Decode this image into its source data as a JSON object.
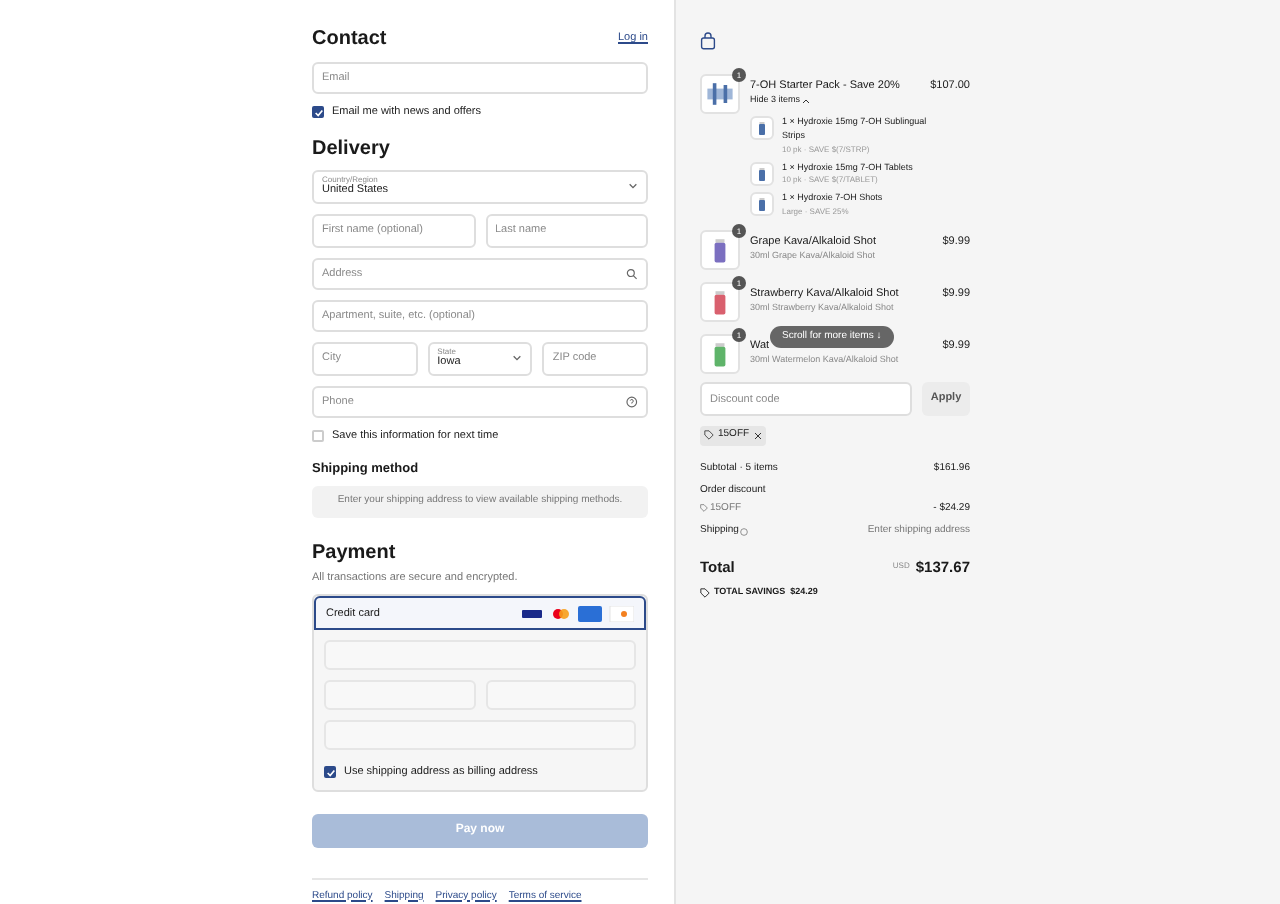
{
  "contact": {
    "title": "Contact",
    "login_link": "Log in",
    "email": {
      "placeholder": "Email"
    },
    "news_checkbox": {
      "label": "Email me with news and offers",
      "checked": true
    }
  },
  "delivery": {
    "title": "Delivery",
    "country": {
      "label": "Country/Region",
      "value": "United States"
    },
    "first_name": {
      "placeholder": "First name (optional)"
    },
    "last_name": {
      "placeholder": "Last name"
    },
    "address": {
      "placeholder": "Address"
    },
    "apartment": {
      "placeholder": "Apartment, suite, etc. (optional)"
    },
    "city": {
      "placeholder": "City"
    },
    "state": {
      "label": "State",
      "value": "Iowa"
    },
    "zip": {
      "placeholder": "ZIP code"
    },
    "phone": {
      "placeholder": "Phone"
    },
    "save_checkbox": {
      "label": "Save this information for next time",
      "checked": false
    }
  },
  "shipping_method": {
    "title": "Shipping method",
    "message": "Enter your shipping address to view available shipping methods."
  },
  "payment": {
    "title": "Payment",
    "subtitle": "All transactions are secure and encrypted.",
    "method": "Credit card",
    "billing_checkbox": {
      "label": "Use shipping address as billing address",
      "checked": true
    }
  },
  "pay_button": {
    "label": "Pay now",
    "disabled": true
  },
  "footer_links": [
    "Refund policy",
    "Shipping",
    "Privacy policy",
    "Terms of service"
  ],
  "order": {
    "items": [
      {
        "name": "7-OH Starter Pack - Save 20%",
        "quantity": "1",
        "price": "$107.00",
        "toggle": "Hide 3 items",
        "expanded": true,
        "children": [
          {
            "name": "1 × Hydroxie 15mg 7-OH Sublingual Strips",
            "detail": "10 pk · SAVE $(7/STRP)"
          },
          {
            "name": "1 × Hydroxie 15mg 7-OH Tablets",
            "detail": "10 pk · SAVE $(7/TABLET)"
          },
          {
            "name": "1 × Hydroxie 7-OH Shots",
            "detail": "Large · SAVE 25%"
          }
        ]
      },
      {
        "name": "Grape Kava/Alkaloid Shot",
        "detail": "30ml Grape Kava/Alkaloid Shot",
        "quantity": "1",
        "price": "$9.99",
        "color": "#7b6fc0"
      },
      {
        "name": "Strawberry Kava/Alkaloid Shot",
        "detail": "30ml Strawberry Kava/Alkaloid Shot",
        "quantity": "1",
        "price": "$9.99",
        "color": "#d9606e"
      },
      {
        "name": "Wat",
        "detail": "30ml Watermelon Kava/Alkaloid Shot",
        "quantity": "1",
        "price": "$9.99",
        "color": "#5fb46a"
      }
    ],
    "scroll_hint": "Scroll for more items ↓",
    "discount": {
      "placeholder": "Discount code",
      "button": "Apply",
      "applied_code": "15OFF"
    },
    "summary": {
      "subtotal_label": "Subtotal · 5 items",
      "subtotal": "$161.96",
      "discount_label": "Order discount",
      "discount_code": "15OFF",
      "discount_value": "- $24.29",
      "shipping_label": "Shipping",
      "shipping_value": "Enter shipping address",
      "total_label": "Total",
      "currency": "USD",
      "total": "$137.67",
      "savings": "TOTAL SAVINGS  $24.29"
    }
  }
}
